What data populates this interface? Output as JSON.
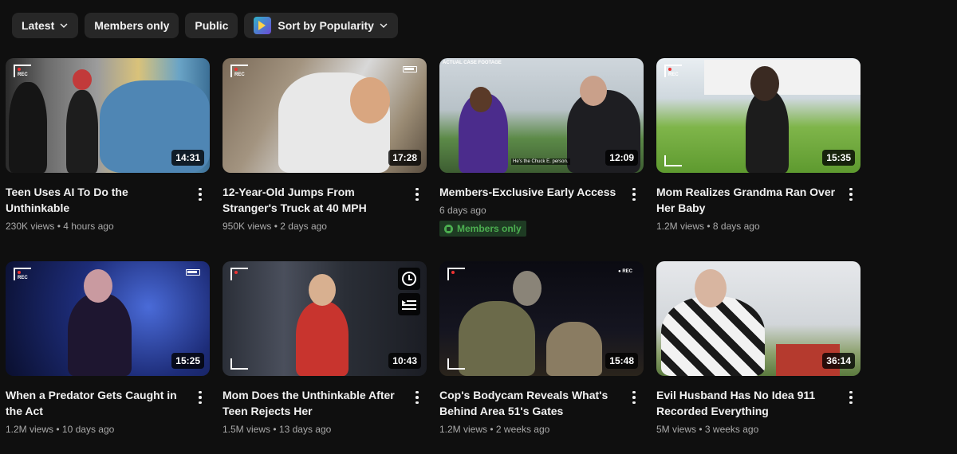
{
  "filters": {
    "latest": "Latest",
    "members_only": "Members only",
    "public": "Public",
    "sort": "Sort by Popularity"
  },
  "videos": [
    {
      "title": "Teen Uses AI To Do the Unthinkable",
      "views": "230K views",
      "age": "4 hours ago",
      "duration": "14:31"
    },
    {
      "title": "12-Year-Old Jumps From Stranger's Truck at 40 MPH",
      "views": "950K views",
      "age": "2 days ago",
      "duration": "17:28"
    },
    {
      "title": "Members-Exclusive Early Access",
      "views": "",
      "age": "6 days ago",
      "duration": "12:09",
      "badge": "Members only",
      "thumb_caption": "He's the Chuck E. person.",
      "thumb_header": "ACTUAL CASE FOOTAGE"
    },
    {
      "title": "Mom Realizes Grandma Ran Over Her Baby",
      "views": "1.2M views",
      "age": "8 days ago",
      "duration": "15:35"
    },
    {
      "title": "When a Predator Gets Caught in the Act",
      "views": "1.2M views",
      "age": "10 days ago",
      "duration": "15:25"
    },
    {
      "title": "Mom Does the Unthinkable After Teen Rejects Her",
      "views": "1.5M views",
      "age": "13 days ago",
      "duration": "10:43"
    },
    {
      "title": "Cop's Bodycam Reveals What's Behind Area 51's Gates",
      "views": "1.2M views",
      "age": "2 weeks ago",
      "duration": "15:48"
    },
    {
      "title": "Evil Husband Has No Idea 911 Recorded Everything",
      "views": "5M views",
      "age": "3 weeks ago",
      "duration": "36:14"
    }
  ],
  "separator": "•",
  "icons": {
    "chevron": "chevron-down-icon",
    "more": "more-vert-icon",
    "watch_later": "clock-icon",
    "add_to_queue": "queue-icon",
    "members": "members-badge-icon"
  },
  "colors": {
    "background": "#0f0f0f",
    "chip": "#272727",
    "members_green": "#4caf50"
  }
}
